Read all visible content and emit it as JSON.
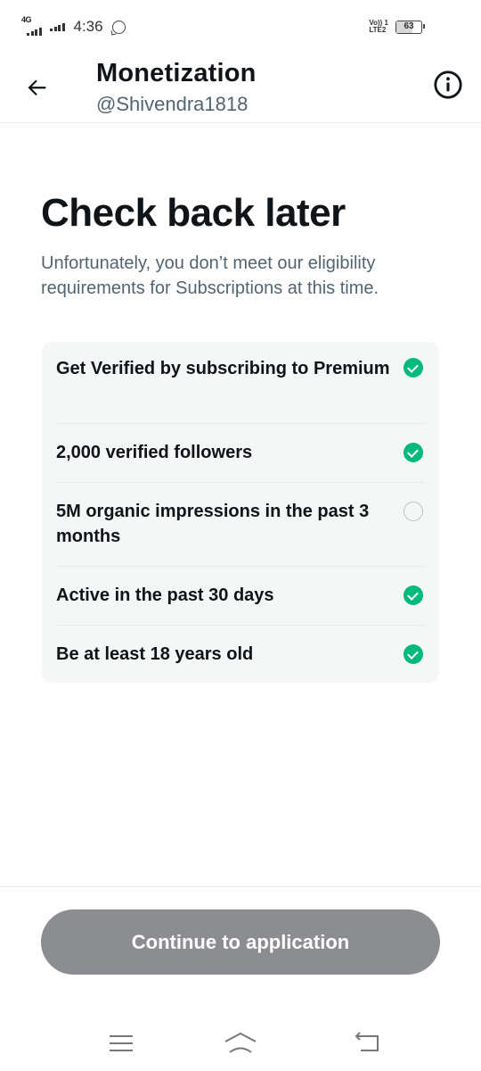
{
  "status_bar": {
    "network_left": "4G",
    "time": "4:36",
    "volte_line1": "Vo)) 1",
    "volte_line2": "LTE2",
    "battery": "63",
    "battery_level": 0.63
  },
  "header": {
    "title": "Monetization",
    "handle": "@Shivendra1818"
  },
  "main": {
    "title": "Check back later",
    "subtitle": "Unfortunately, you don’t meet our eligibility requirements for Subscriptions at this time."
  },
  "requirements": [
    {
      "label": "Get Verified by subscribing to Premium",
      "met": true
    },
    {
      "label": "2,000 verified followers",
      "met": true
    },
    {
      "label": "5M organic impressions in the past 3 months",
      "met": false
    },
    {
      "label": "Active in the past 30 days",
      "met": true
    },
    {
      "label": "Be at least 18 years old",
      "met": true
    }
  ],
  "action": {
    "continue_label": "Continue to application",
    "disabled": true
  },
  "colors": {
    "check_green": "#00ba7c",
    "button_disabled": "#8b8d90",
    "secondary_text": "#536471"
  },
  "icons": {
    "back": "arrow-left-icon",
    "info": "info-icon",
    "menu": "menu-icon",
    "home": "home-icon",
    "return": "back-icon"
  }
}
